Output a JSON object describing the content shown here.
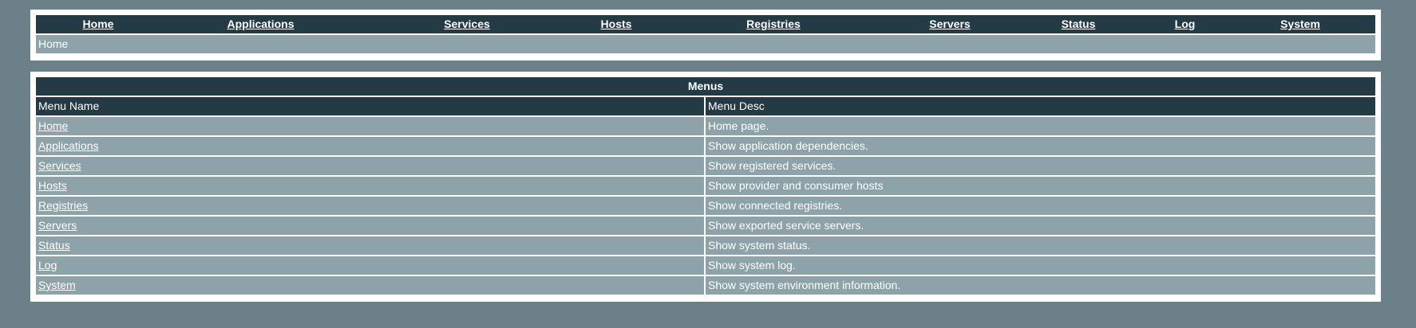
{
  "nav": {
    "items": [
      {
        "label": "Home"
      },
      {
        "label": "Applications"
      },
      {
        "label": "Services"
      },
      {
        "label": "Hosts"
      },
      {
        "label": "Registries"
      },
      {
        "label": "Servers"
      },
      {
        "label": "Status"
      },
      {
        "label": "Log"
      },
      {
        "label": "System"
      }
    ]
  },
  "breadcrumb": {
    "text": "Home"
  },
  "menus": {
    "title": "Menus",
    "headers": {
      "name": "Menu Name",
      "desc": "Menu Desc"
    },
    "rows": [
      {
        "name": "Home",
        "desc": "Home page."
      },
      {
        "name": "Applications",
        "desc": "Show application dependencies."
      },
      {
        "name": "Services",
        "desc": "Show registered services."
      },
      {
        "name": "Hosts",
        "desc": "Show provider and consumer hosts"
      },
      {
        "name": "Registries",
        "desc": "Show connected registries."
      },
      {
        "name": "Servers",
        "desc": "Show exported service servers."
      },
      {
        "name": "Status",
        "desc": "Show system status."
      },
      {
        "name": "Log",
        "desc": "Show system log."
      },
      {
        "name": "System",
        "desc": "Show system environment information."
      }
    ]
  },
  "colors": {
    "background": "#6b8088",
    "header_dark": "#243a44",
    "row_light": "#8ea2aa",
    "panel": "#ffffff"
  }
}
